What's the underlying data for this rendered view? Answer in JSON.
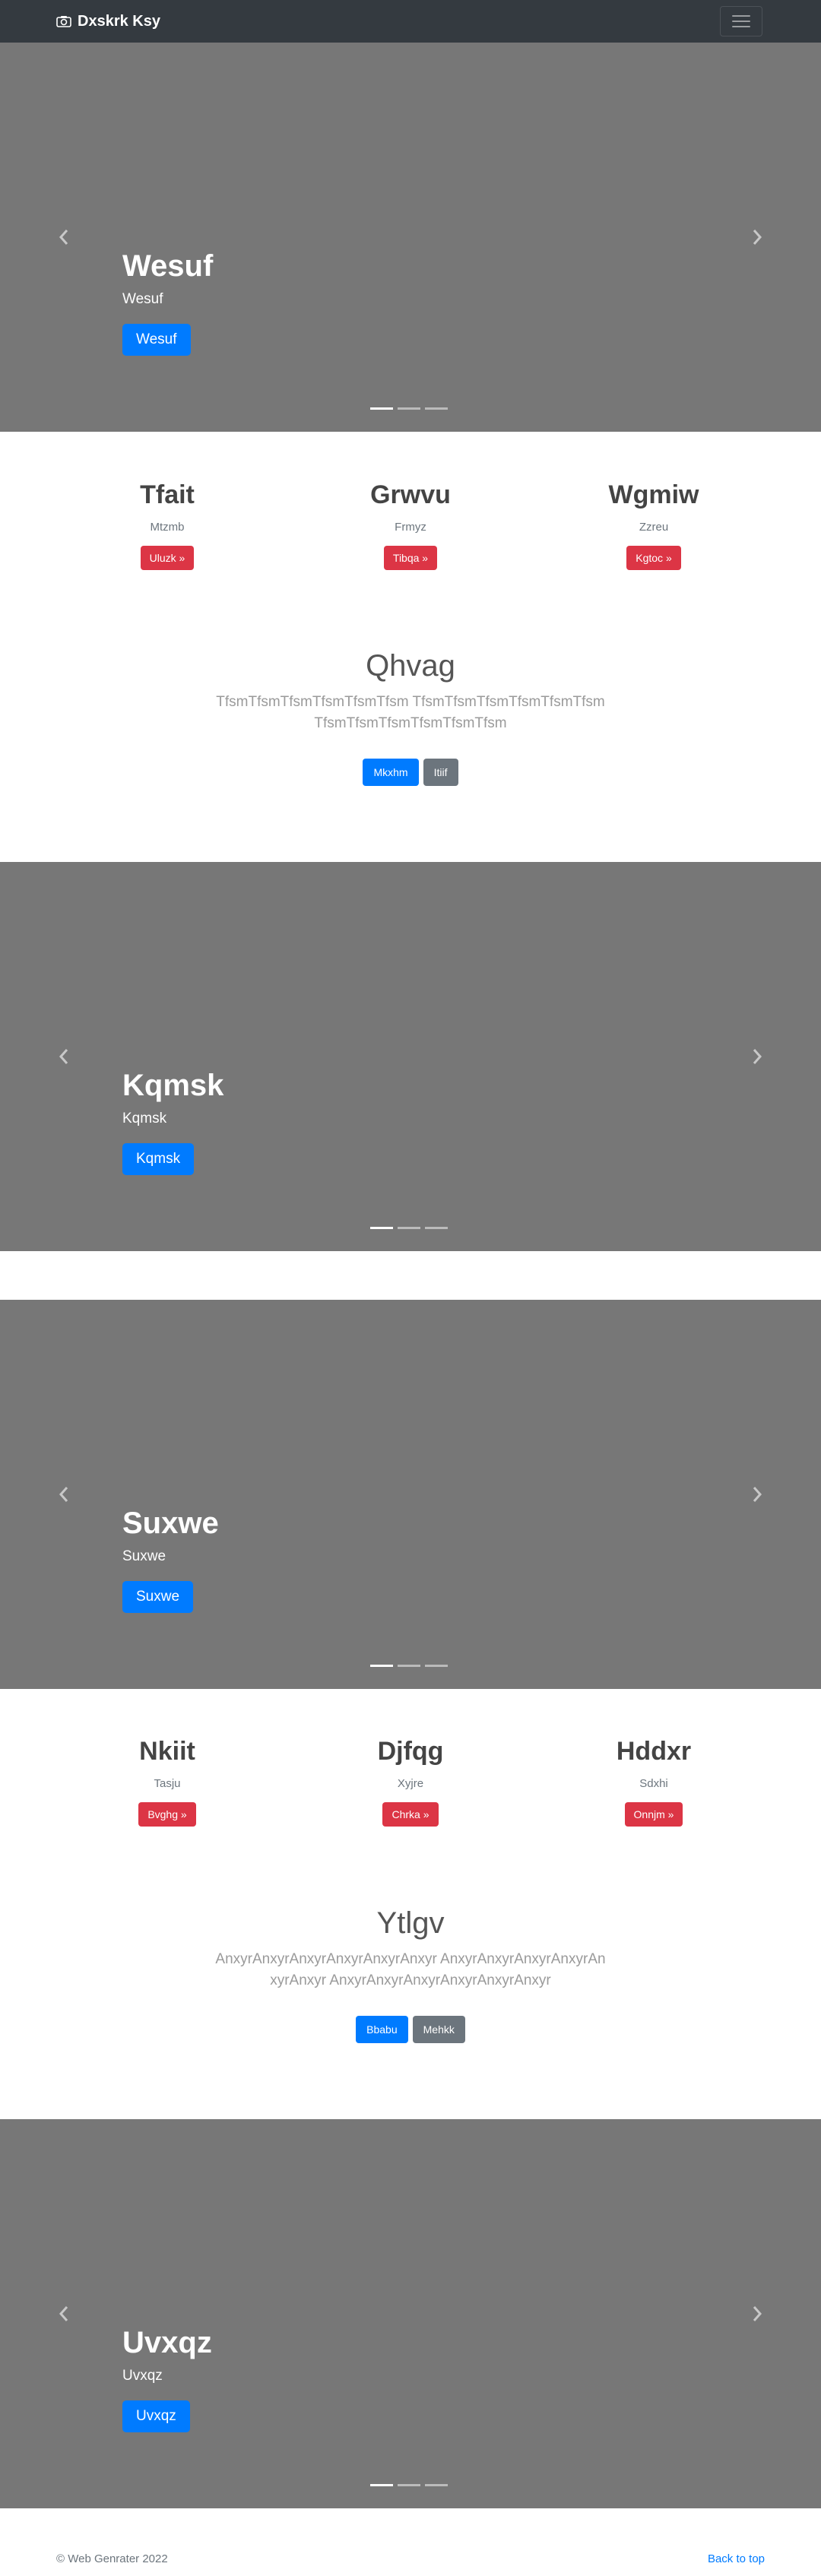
{
  "navbar": {
    "brand": "Dxskrk Ksy",
    "brand_icon": "camera-icon",
    "toggler_icon": "menu-icon"
  },
  "carousels": [
    {
      "title": "Wesuf",
      "subtitle": "Wesuf",
      "button": "Wesuf"
    },
    {
      "title": "Kqmsk",
      "subtitle": "Kqmsk",
      "button": "Kqmsk"
    },
    {
      "title": "Suxwe",
      "subtitle": "Suxwe",
      "button": "Suxwe"
    },
    {
      "title": "Uvxqz",
      "subtitle": "Uvxqz",
      "button": "Uvxqz"
    }
  ],
  "marketing1": [
    {
      "heading": "Tfait",
      "text": "Mtzmb",
      "button": "Uluzk »"
    },
    {
      "heading": "Grwvu",
      "text": "Frmyz",
      "button": "Tibqa »"
    },
    {
      "heading": "Wgmiw",
      "text": "Zzreu",
      "button": "Kgtoc »"
    }
  ],
  "jumbotron1": {
    "heading": "Qhvag",
    "text": "TfsmTfsmTfsmTfsmTfsmTfsm TfsmTfsmTfsmTfsmTfsmTfsm TfsmTfsmTfsmTfsmTfsmTfsm",
    "primary": "Mkxhm",
    "secondary": "Itiif"
  },
  "marketing2": [
    {
      "heading": "Nkiit",
      "text": "Tasju",
      "button": "Bvghg »"
    },
    {
      "heading": "Djfqg",
      "text": "Xyjre",
      "button": "Chrka »"
    },
    {
      "heading": "Hddxr",
      "text": "Sdxhi",
      "button": "Onnjm »"
    }
  ],
  "jumbotron2": {
    "heading": "Ytlgv",
    "text": "AnxyrAnxyrAnxyrAnxyrAnxyrAnxyr AnxyrAnxyrAnxyrAnxyrAnxyrAnxyr AnxyrAnxyrAnxyrAnxyrAnxyrAnxyr",
    "primary": "Bbabu",
    "secondary": "Mehkk"
  },
  "footer": {
    "copyright": "© Web Genrater 2022",
    "back_to_top": "Back to top"
  }
}
